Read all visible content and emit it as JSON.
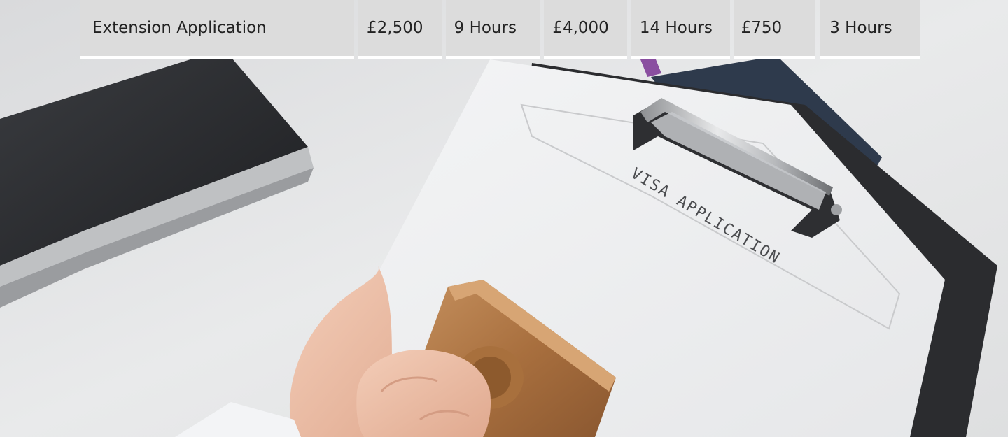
{
  "hero": {
    "stamped_text": "VISA APPLICATION"
  },
  "fee_table": {
    "row": {
      "service": "Extension Application",
      "price_1": "£2,500",
      "time_1": "9 Hours",
      "price_2": "£4,000",
      "time_2": "14 Hours",
      "price_3": "£750",
      "time_3": "3 Hours"
    }
  }
}
